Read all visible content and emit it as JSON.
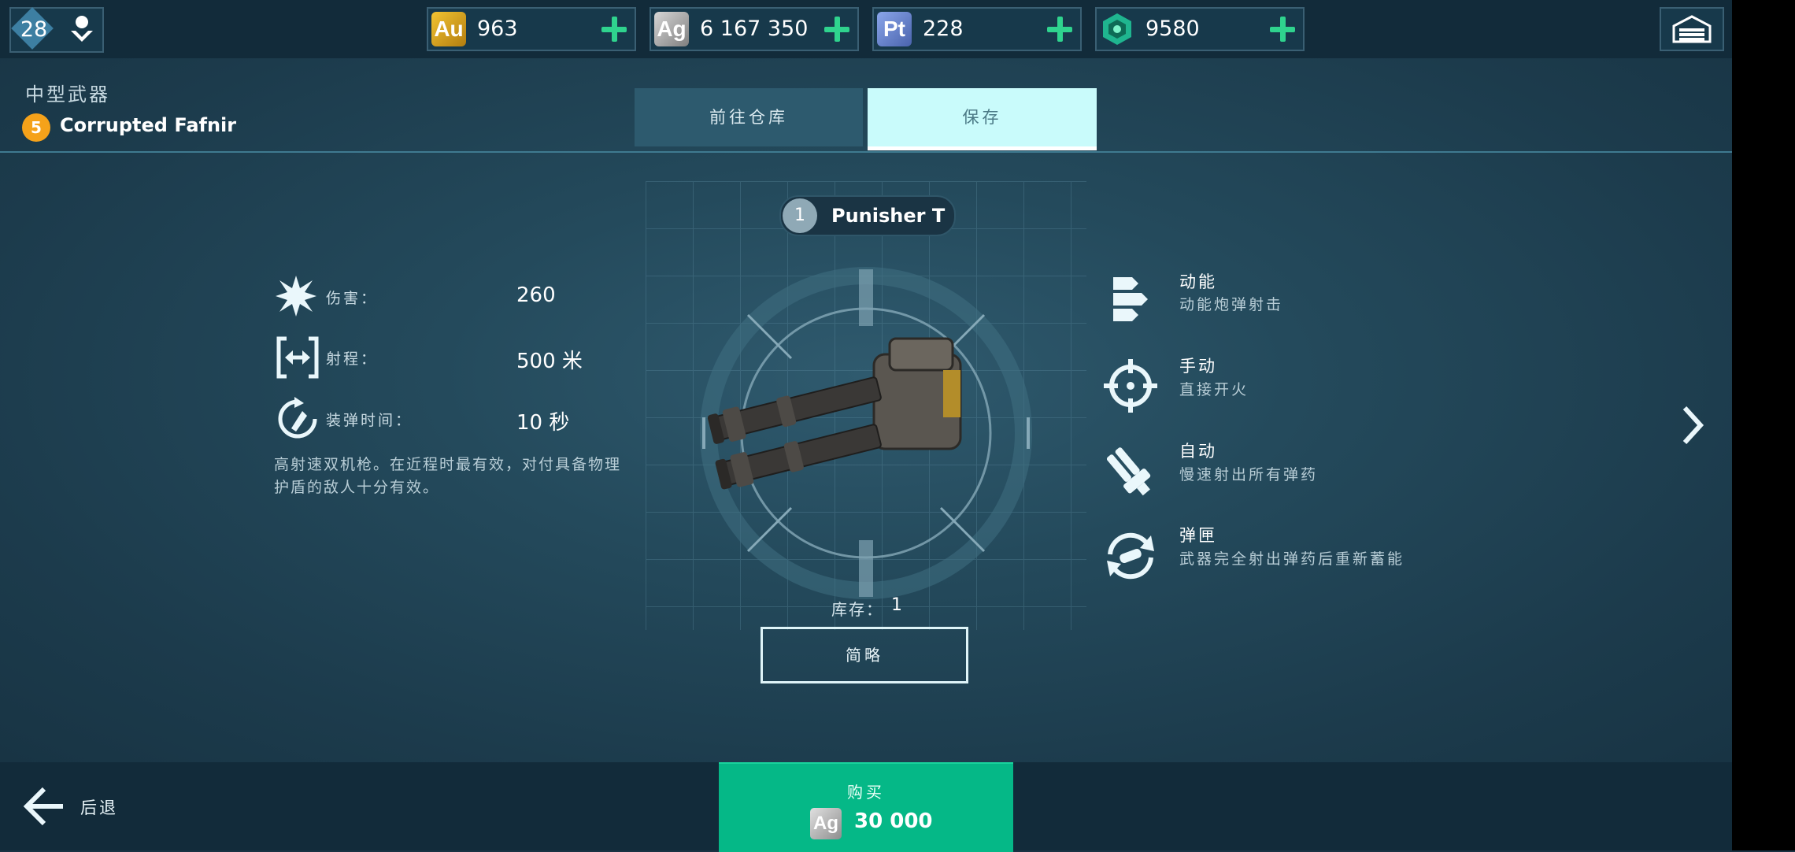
{
  "topbar": {
    "level": "28",
    "currencies": [
      {
        "code": "Au",
        "amount": "963",
        "color": "#d9a520"
      },
      {
        "code": "Ag",
        "amount": "6 167 350",
        "color": "#9c9c9c"
      },
      {
        "code": "Pt",
        "amount": "228",
        "color": "#5f7ec9"
      },
      {
        "code": "",
        "amount": "9580",
        "color": "#1fb58f"
      }
    ]
  },
  "header": {
    "category": "中型武器",
    "rank": "5",
    "weapon_name": "Corrupted Fafnir"
  },
  "tabs": {
    "go_to_hangar": "前往仓库",
    "save": "保存"
  },
  "weapon": {
    "slot": "1",
    "name": "Punisher T",
    "stock_label": "库存：",
    "stock": "1",
    "summary_button": "简略"
  },
  "stats": [
    {
      "label": "伤害：",
      "value": "260"
    },
    {
      "label": "射程：",
      "value": "500 米"
    },
    {
      "label": "装弹时间：",
      "value": "10 秒"
    }
  ],
  "description": "高射速双机枪。在近程时最有效，对付具备物理护盾的敌人十分有效。",
  "features": [
    {
      "title": "动能",
      "subtitle": "动能炮弹射击",
      "icon": "kinetic-icon"
    },
    {
      "title": "手动",
      "subtitle": "直接开火",
      "icon": "crosshair-icon"
    },
    {
      "title": "自动",
      "subtitle": "慢速射出所有弹药",
      "icon": "auto-fire-icon"
    },
    {
      "title": "弹匣",
      "subtitle": "武器完全射出弹药后重新蓄能",
      "icon": "magazine-reload-icon"
    }
  ],
  "bottom": {
    "back_label": "后退",
    "buy_label": "购买",
    "price_currency": "Ag",
    "price": "30 000"
  }
}
